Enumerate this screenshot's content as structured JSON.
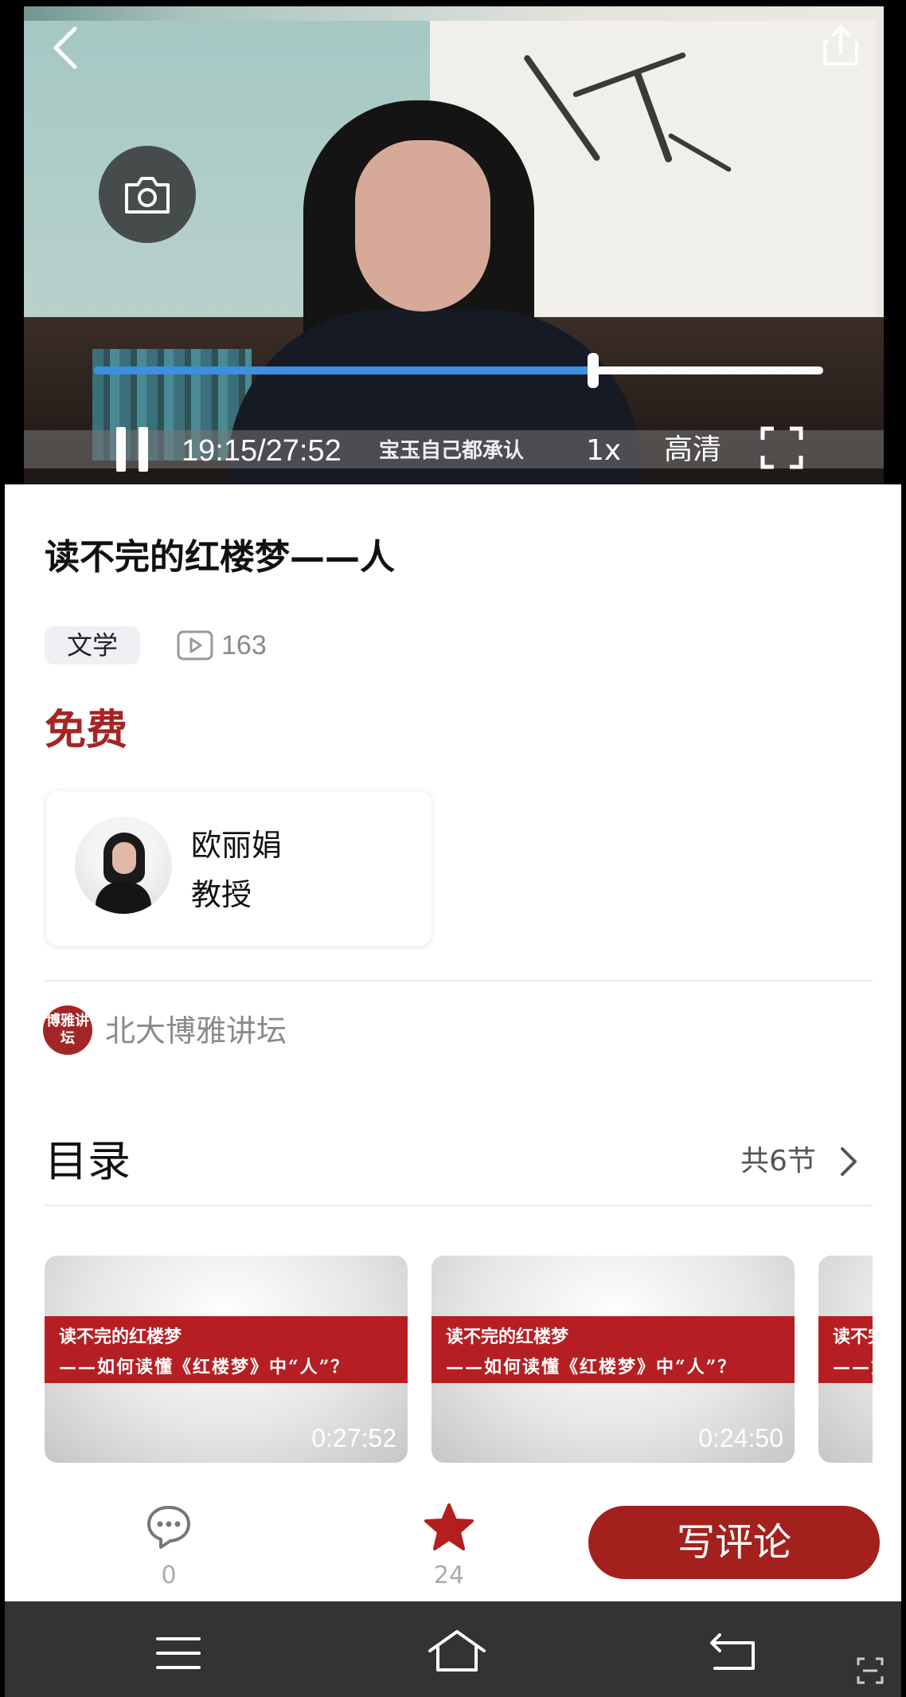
{
  "player": {
    "current_time": "19:15",
    "duration": "27:52",
    "time_display": "19:15/27:52",
    "subtitle": "宝玉自己都承认",
    "speed": "1x",
    "quality": "高清",
    "progress": 0.685,
    "accent_color": "#3d8fe0"
  },
  "course": {
    "title": "读不完的红楼梦——人",
    "tag": "文学",
    "views": "163",
    "price": "免费",
    "price_color": "#a32626"
  },
  "teacher": {
    "name": "欧丽娟",
    "role": "教授"
  },
  "source": {
    "logo_text": "博雅讲坛",
    "name": "北大博雅讲坛"
  },
  "catalog": {
    "title": "目录",
    "count": "共6节",
    "episodes": [
      {
        "line1": "读不完的红楼梦",
        "line2": "——如何读懂《红楼梦》中“人”？",
        "duration": "0:27:52"
      },
      {
        "line1": "读不完的红楼梦",
        "line2": "——如何读懂《红楼梦》中“人”？",
        "duration": "0:24:50"
      },
      {
        "line1": "读不完的红楼梦",
        "line2": "——如何读懂《红楼梦》中“人”？",
        "duration": ""
      }
    ]
  },
  "actions": {
    "comment_count": "0",
    "star_count": "24",
    "write_comment": "写评论",
    "brand_color": "#a3201c"
  },
  "icons": [
    "back-icon",
    "share-icon",
    "camera-icon",
    "pause-icon",
    "fullscreen-icon",
    "play-count-icon",
    "chevron-right-icon",
    "comment-icon",
    "star-icon",
    "menu-icon",
    "home-icon",
    "back-sys-icon",
    "scan-icon"
  ]
}
